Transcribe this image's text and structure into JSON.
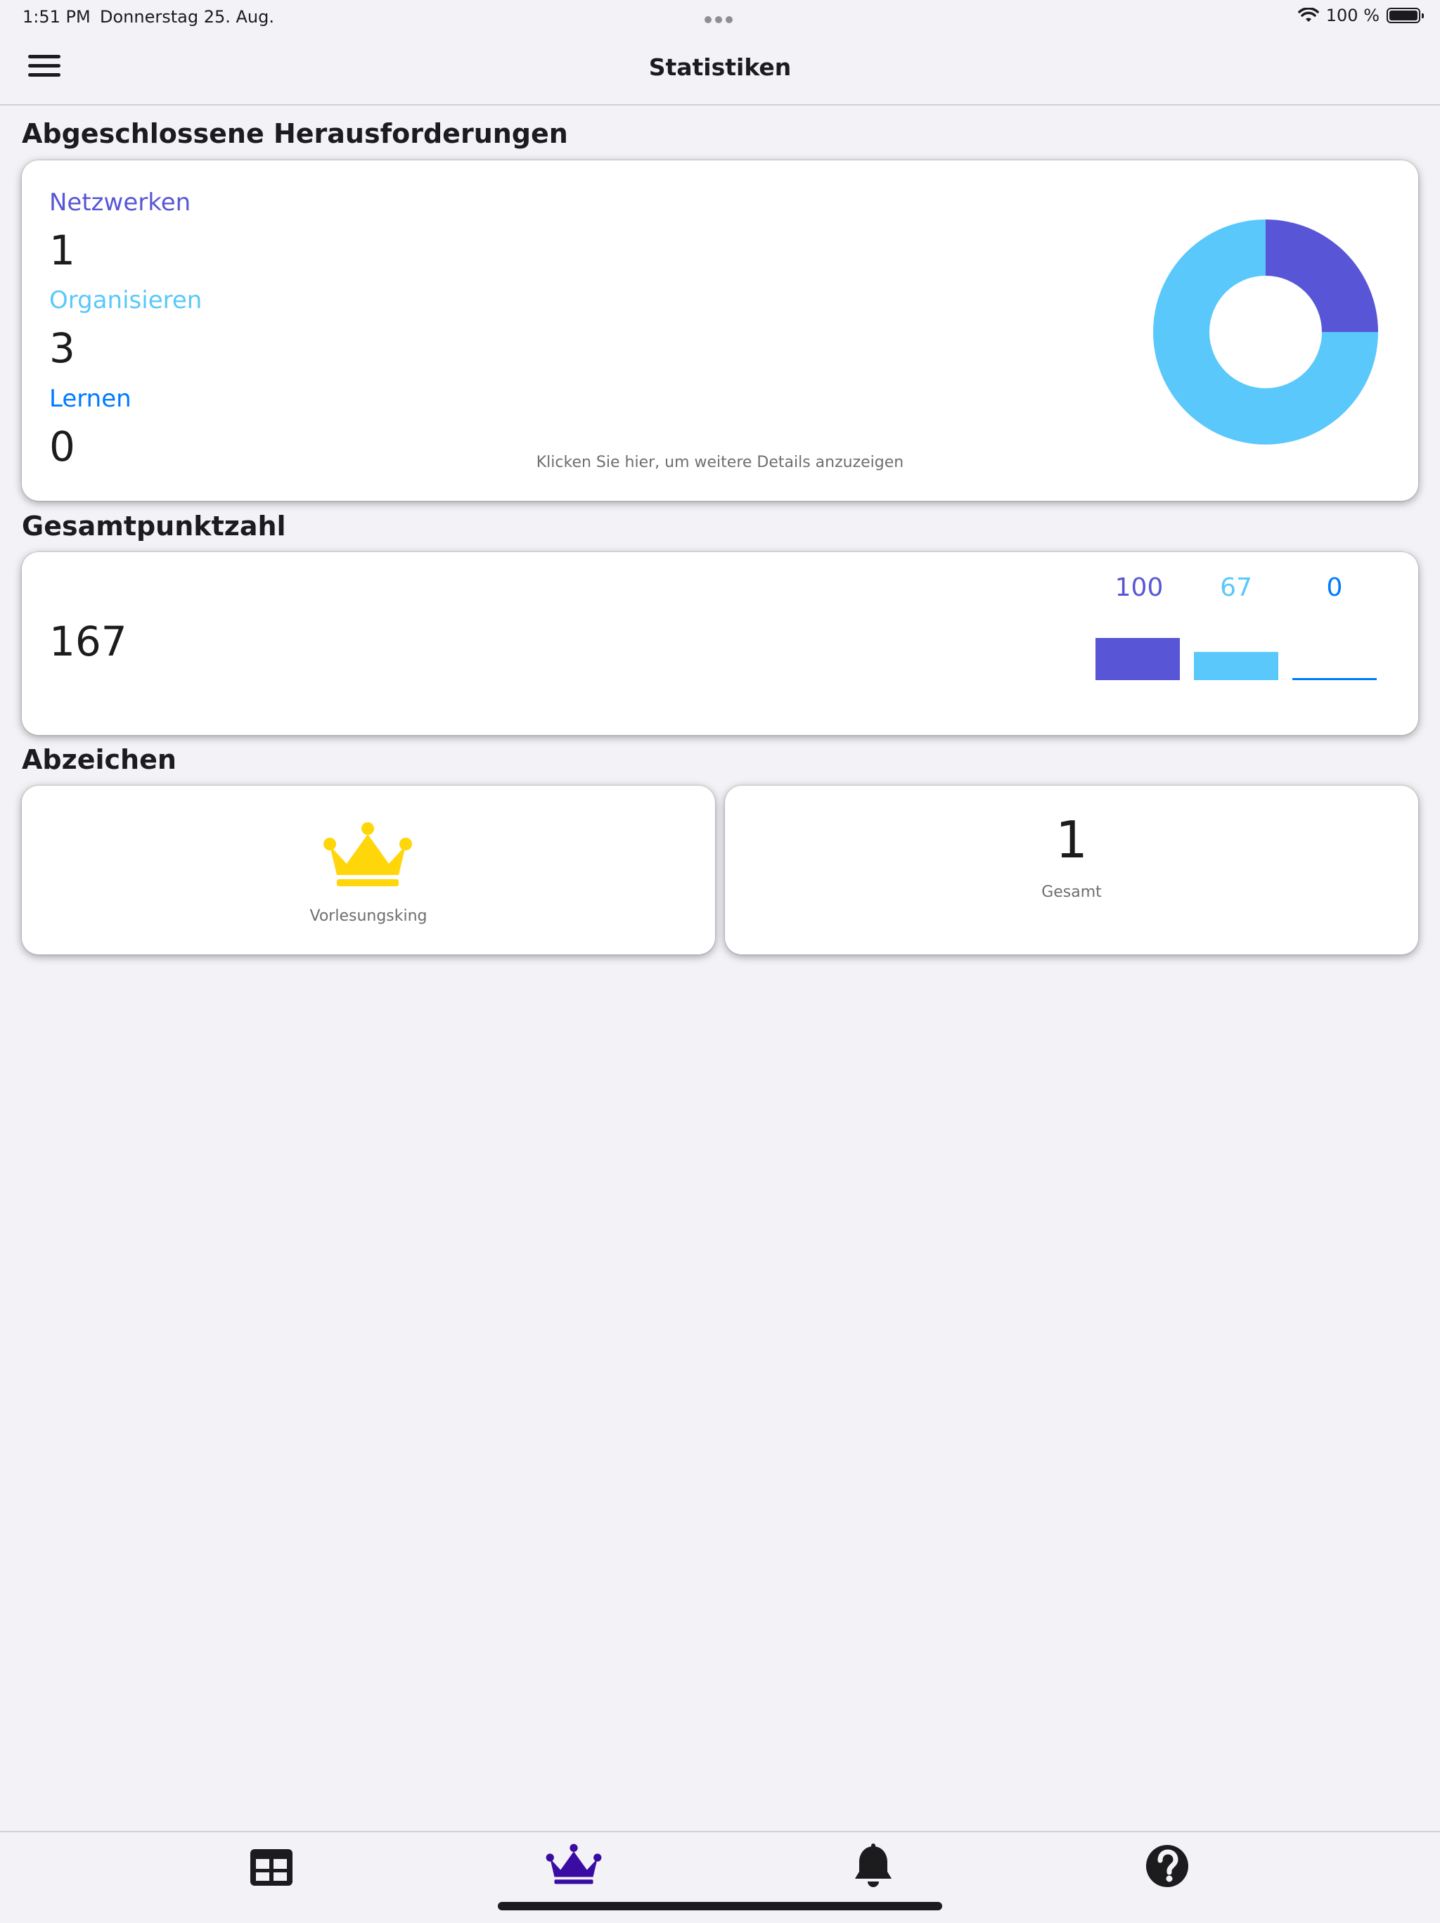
{
  "status_bar": {
    "time": "1:51 PM",
    "date": "Donnerstag 25. Aug.",
    "battery": "100 %",
    "icons": [
      "wifi-icon",
      "battery-icon"
    ]
  },
  "nav": {
    "title": "Statistiken",
    "menu_icon": "hamburger-menu-icon"
  },
  "colors": {
    "netzwerken": "#5856d6",
    "organisieren": "#5ac8fa",
    "lernen": "#007aff",
    "crown_gold": "#ffd60a",
    "tab_active": "#3a0ca3",
    "background": "#f2f2f7"
  },
  "challenges": {
    "title": "Abgeschlossene Herausforderungen",
    "items": [
      {
        "label": "Netzwerken",
        "value": "1"
      },
      {
        "label": "Organisieren",
        "value": "3"
      },
      {
        "label": "Lernen",
        "value": "0"
      }
    ],
    "hint": "Klicken Sie hier, um weitere Details anzuzeigen"
  },
  "score": {
    "title": "Gesamtpunktzahl",
    "total": "167",
    "bars": [
      {
        "label": "100",
        "value": 100
      },
      {
        "label": "67",
        "value": 67
      },
      {
        "label": "0",
        "value": 0
      }
    ]
  },
  "badges": {
    "title": "Abzeichen",
    "badge_name": "Vorlesungsking",
    "badge_icon": "crown-icon",
    "count": "1",
    "count_label": "Gesamt"
  },
  "chart_data": [
    {
      "type": "pie",
      "categories": [
        "Netzwerken",
        "Organisieren",
        "Lernen"
      ],
      "values": [
        1,
        3,
        0
      ]
    },
    {
      "type": "bar",
      "categories": [
        "Netzwerken",
        "Organisieren",
        "Lernen"
      ],
      "values": [
        100,
        67,
        0
      ]
    }
  ],
  "tab_bar": {
    "tabs": [
      {
        "icon": "grid-icon",
        "active": false
      },
      {
        "icon": "crown-icon",
        "active": true
      },
      {
        "icon": "bell-icon",
        "active": false
      },
      {
        "icon": "help-icon",
        "active": false
      }
    ]
  }
}
